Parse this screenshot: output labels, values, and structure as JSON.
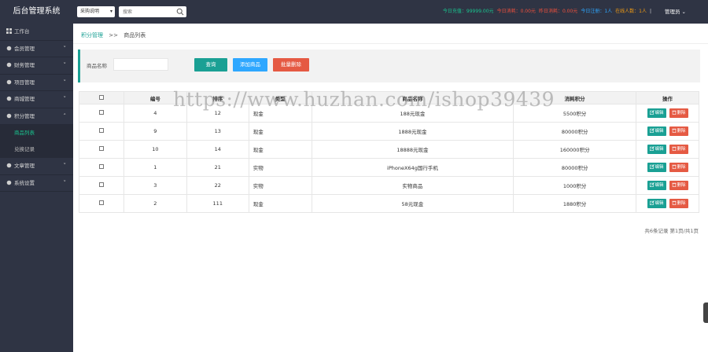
{
  "app": {
    "title": "后台管理系统"
  },
  "topbar": {
    "select_value": "采购说明",
    "search_placeholder": "搜索",
    "stats": [
      {
        "label": "今日充值：99999.00元",
        "color": "#19c38e"
      },
      {
        "label": "今日消耗：0.00元",
        "color": "#f0503c"
      },
      {
        "label": "昨日消耗：0.00元",
        "color": "#f0503c"
      },
      {
        "label": "今日注册：1人",
        "color": "#2ea7ff"
      },
      {
        "label": "在线人数：1人",
        "color": "#f39c12"
      }
    ],
    "separator": "|",
    "user": "管理员"
  },
  "sidebar": {
    "items": [
      {
        "label": "工作台",
        "has_chevron": false
      },
      {
        "label": "会员管理",
        "has_chevron": true
      },
      {
        "label": "财务管理",
        "has_chevron": true
      },
      {
        "label": "项目管理",
        "has_chevron": true
      },
      {
        "label": "商城管理",
        "has_chevron": true
      },
      {
        "label": "积分管理",
        "has_chevron": true,
        "expanded": true
      }
    ],
    "subitems": [
      {
        "label": "商品列表",
        "active": true
      },
      {
        "label": "兑换记录",
        "active": false
      }
    ],
    "items_after": [
      {
        "label": "文章管理",
        "has_chevron": true
      },
      {
        "label": "系统设置",
        "has_chevron": true
      }
    ]
  },
  "breadcrumb": {
    "home": "积分管理",
    "sep": ">>",
    "current": "商品列表"
  },
  "filter": {
    "label": "商品名称",
    "search_btn": "查询",
    "add_btn": "添加商品",
    "batch_delete_btn": "批量删除"
  },
  "table": {
    "headers": [
      "",
      "编号",
      "排序",
      "类型",
      "商品名称",
      "消耗积分",
      "操作"
    ],
    "rows": [
      {
        "id": "4",
        "sort": "12",
        "type": "现金",
        "name": "188元现金",
        "points": "5500积分"
      },
      {
        "id": "9",
        "sort": "13",
        "type": "现金",
        "name": "1888元现金",
        "points": "80000积分"
      },
      {
        "id": "10",
        "sort": "14",
        "type": "现金",
        "name": "18888元现金",
        "points": "160000积分"
      },
      {
        "id": "1",
        "sort": "21",
        "type": "实物",
        "name": "iPhoneX64g国行手机",
        "points": "80000积分"
      },
      {
        "id": "3",
        "sort": "22",
        "type": "实物",
        "name": "实物商品",
        "points": "1000积分"
      },
      {
        "id": "2",
        "sort": "111",
        "type": "现金",
        "name": "58元现金",
        "points": "1880积分"
      }
    ],
    "edit_label": "编辑",
    "delete_label": "删除"
  },
  "pager": {
    "text": "共6条记录 第1页/共1页"
  },
  "watermark": "https://www.huzhan.com/ishop39439"
}
